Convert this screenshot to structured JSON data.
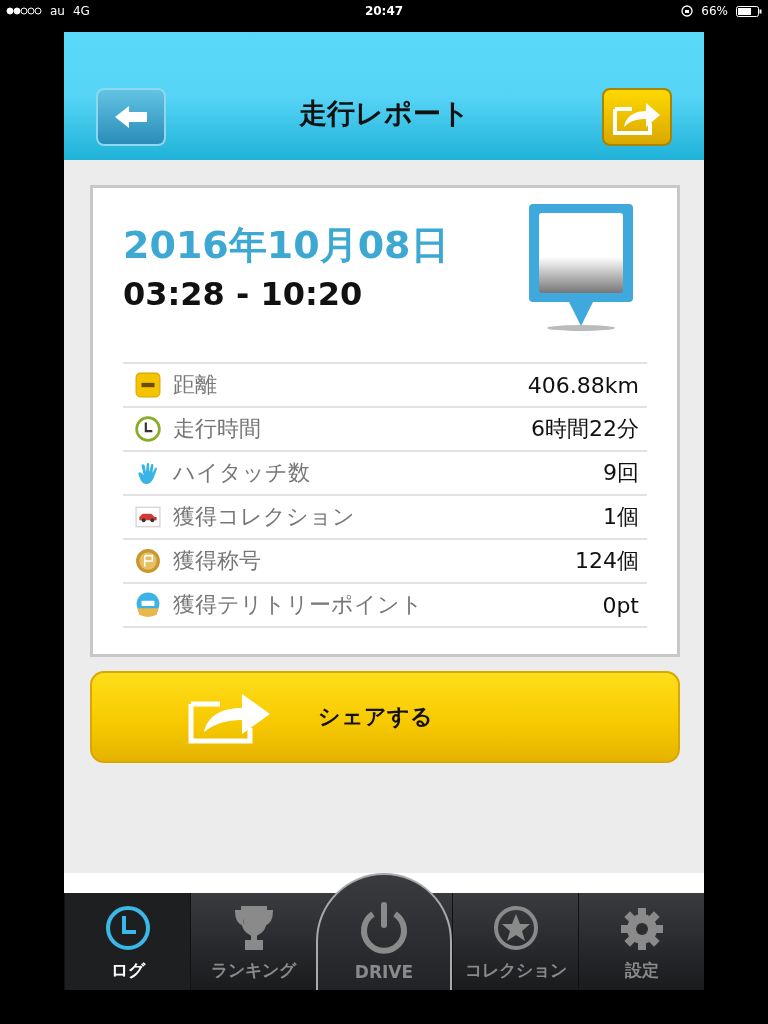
{
  "status_bar": {
    "carrier": "au",
    "network": "4G",
    "time": "20:47",
    "battery": "66%"
  },
  "header": {
    "title": "走行レポート"
  },
  "report": {
    "date": "2016年10月08日",
    "time_range": "03:28 - 10:20",
    "stats": [
      {
        "kind": "distance",
        "label": "距離",
        "value": "406.88km"
      },
      {
        "kind": "time",
        "label": "走行時間",
        "value": "6時間22分"
      },
      {
        "kind": "hightouch",
        "label": "ハイタッチ数",
        "value": "9回"
      },
      {
        "kind": "collection",
        "label": "獲得コレクション",
        "value": "1個"
      },
      {
        "kind": "title",
        "label": "獲得称号",
        "value": "124個"
      },
      {
        "kind": "spot",
        "label": "獲得テリトリーポイント",
        "value": "0pt"
      }
    ]
  },
  "share_button": {
    "label": "シェアする"
  },
  "tab_bar": [
    {
      "kind": "log",
      "label": "ログ",
      "selected": true
    },
    {
      "kind": "ranking",
      "label": "ランキング",
      "selected": false
    },
    {
      "kind": "drive",
      "label": "DRIVE",
      "selected": false
    },
    {
      "kind": "collection",
      "label": "コレクション",
      "selected": false
    },
    {
      "kind": "settings",
      "label": "設定",
      "selected": false
    }
  ]
}
